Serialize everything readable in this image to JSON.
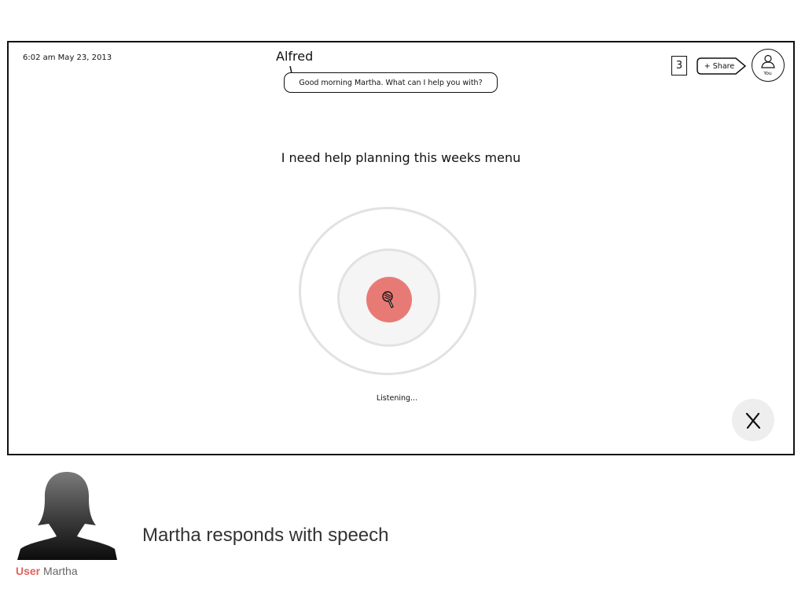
{
  "header": {
    "datetime": "6:02 am May 23, 2013",
    "assistant_name": "Alfred",
    "assistant_message": "Good morning Martha. What can I help you with?",
    "notification_count": "3",
    "share_label": "+ Share",
    "avatar_label": "You"
  },
  "main": {
    "user_utterance": "I need help planning this weeks menu",
    "status_text": "Listening..."
  },
  "controls": {
    "mic_icon": "microphone-icon",
    "close_icon": "close-x-icon",
    "close_label": "X"
  },
  "storyboard": {
    "persona_role": "User",
    "persona_name": "Martha",
    "description": "Martha responds with speech"
  },
  "colors": {
    "accent": "#e87a76",
    "role_label": "#e2635d",
    "ring": "#e2e2e2",
    "close_button_bg": "#eeeeee"
  }
}
